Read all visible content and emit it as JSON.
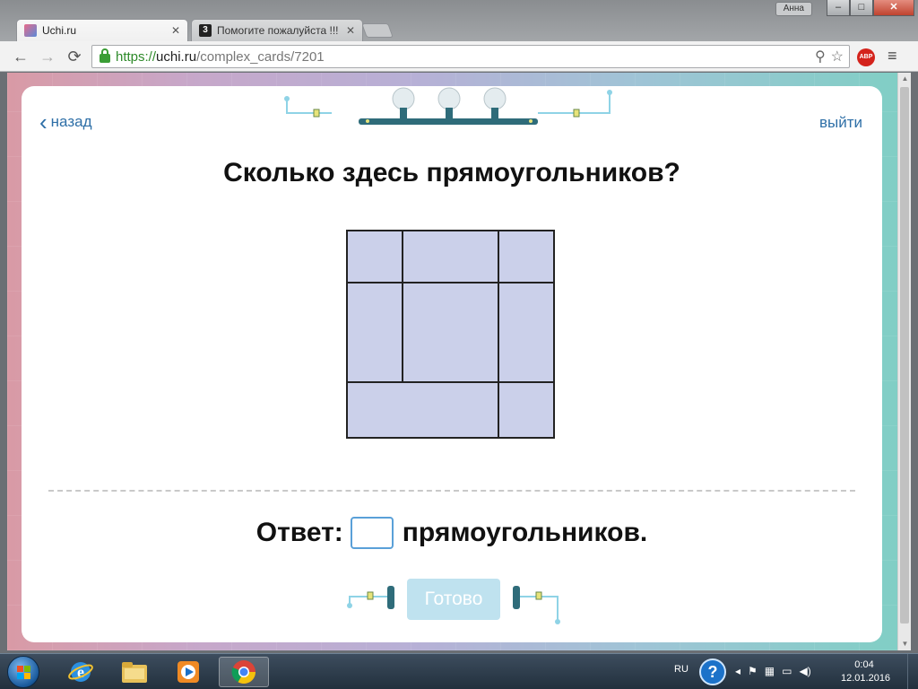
{
  "browser": {
    "user_name": "Анна",
    "window_buttons": {
      "minimize": "–",
      "maximize": "□",
      "close": "✕"
    },
    "tabs": [
      {
        "title": "Uchi.ru",
        "favicon": "uchi-favicon",
        "active": true
      },
      {
        "title": "Помогите пожалуйста !!!",
        "favicon": "znanija-favicon-3",
        "active": false
      }
    ],
    "tab_close": "✕",
    "nav": {
      "back": "←",
      "forward": "→",
      "reload": "⟳"
    },
    "url": {
      "scheme": "https://",
      "host": "uchi.ru",
      "path": "/complex_cards/7201"
    },
    "adblock_label": "ABP",
    "menu_glyph": "≡",
    "zoom_glyph": "⚲",
    "star_glyph": "☆"
  },
  "page": {
    "back_label": "назад",
    "exit_label": "выйти",
    "question": "Сколько здесь прямоугольников?",
    "answer_prefix": "Ответ:",
    "answer_value": "",
    "answer_suffix": "прямоугольников.",
    "ready_label": "Готово",
    "colors": {
      "link": "#2e6fa7",
      "figure_fill": "#cbd0ea",
      "figure_stroke": "#222222",
      "ready_button": "#bfe2ef",
      "input_border": "#5aa0d8"
    }
  },
  "taskbar": {
    "language": "RU",
    "help_glyph": "?",
    "time": "0:04",
    "date": "12.01.2016",
    "icons": [
      "start-orb-icon",
      "internet-explorer-icon",
      "file-explorer-icon",
      "media-player-icon",
      "chrome-icon"
    ]
  }
}
